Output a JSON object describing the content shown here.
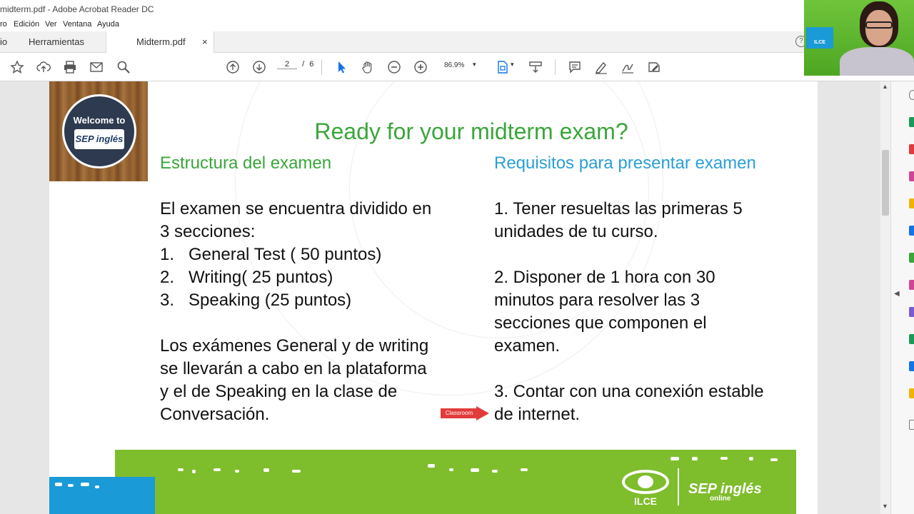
{
  "window": {
    "title": "midterm.pdf - Adobe Acrobat Reader DC"
  },
  "menu": [
    "Edición",
    "Ver",
    "Ventana",
    "Ayuda"
  ],
  "menu_first_fragment": "ro",
  "tabs": {
    "home_fragment": "io",
    "tools": "Herramientas",
    "document": "Midterm.pdf",
    "close": "×"
  },
  "toolbar": {
    "page_current": "2",
    "page_sep": "/",
    "page_total": "6",
    "zoom": "86.9%",
    "caret": "▾"
  },
  "slide": {
    "badge_welcome": "Welcome to",
    "badge_logo": "SEP inglés",
    "title": "Ready for your midterm exam?",
    "left_heading": "Estructura del examen",
    "right_heading": "Requisitos para presentar examen",
    "left_intro": [
      "El examen se encuentra dividido en",
      "3 secciones:"
    ],
    "left_list": [
      {
        "n": "1.",
        "text": "General Test  ( 50 puntos)"
      },
      {
        "n": "2.",
        "text": "Writing( 25 puntos)"
      },
      {
        "n": "3.",
        "text": "Speaking (25  puntos)"
      }
    ],
    "left_outro": [
      "Los exámenes General y de writing",
      "se llevarán a cabo en la plataforma",
      "y el de Speaking en la clase de",
      "Conversación."
    ],
    "right_p1": [
      "1. Tener resueltas las primeras 5",
      "unidades de tu curso."
    ],
    "right_p2": [
      "2. Disponer de 1 hora con 30",
      "minutos para resolver las 3",
      "secciones que componen el",
      "examen."
    ],
    "right_p3": [
      "3. Contar con una conexión estable",
      "de internet."
    ],
    "annotation": "Classroom",
    "footer_ilce": "ILCE",
    "footer_sep": "SEP inglés",
    "footer_online": "online"
  },
  "webcam": {
    "logo_text": "ILCE"
  },
  "colors": {
    "title_green": "#3aa63a",
    "heading_blue": "#2a9fd6",
    "band_green": "#7ebd2c",
    "band_blue": "#1a9ad6",
    "annotation_red": "#e23b3b"
  }
}
